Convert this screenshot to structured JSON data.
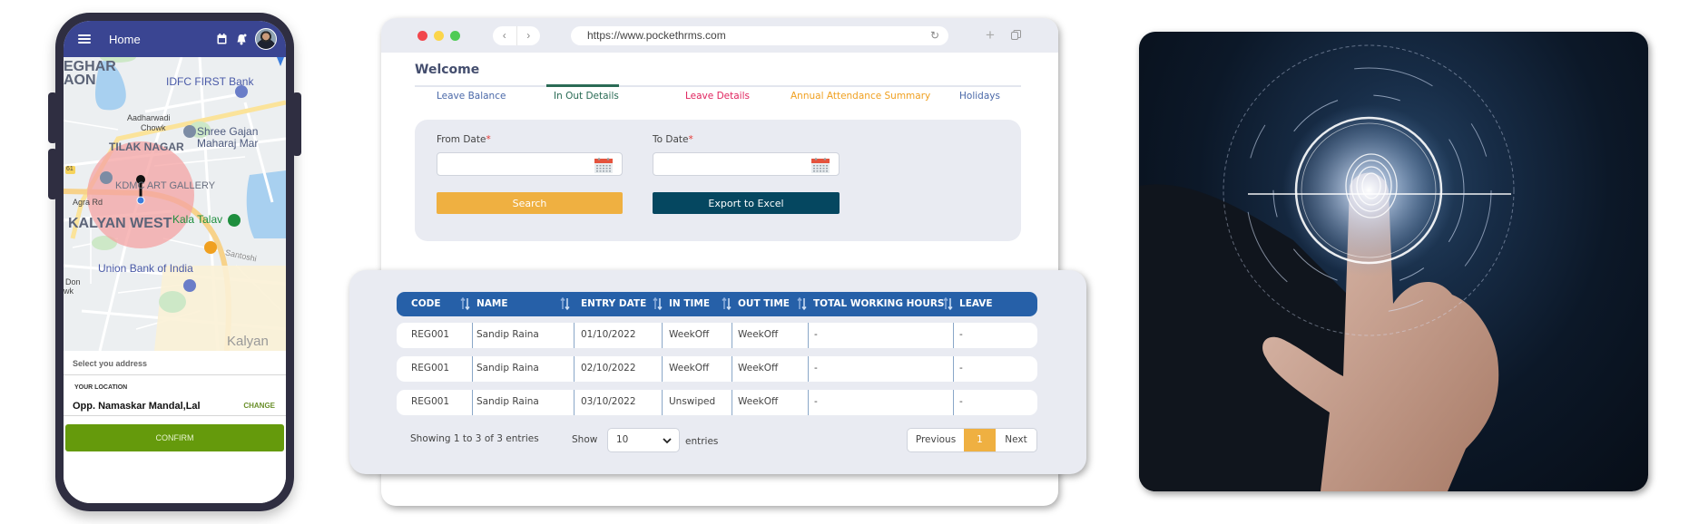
{
  "phone": {
    "header": {
      "menu_icon": "hamburger-icon",
      "title": "Home",
      "icons": [
        "calendar-icon",
        "bell-icon",
        "avatar"
      ]
    },
    "map": {
      "labels": {
        "eghar": "EGHAR",
        "aon": "AON",
        "idfc": "IDFC FIRST Bank",
        "aadharwadi": "Aadharwadi",
        "chowk": "Chowk",
        "tilak_nagar": "TILAK NAGAR",
        "shree1": "Shree Gajan",
        "shree2": "Maharaj Mar",
        "kdmc": "KDMC ART GALLERY",
        "agra_rd": "Agra Rd",
        "kalyan_west": "KALYAN WEST",
        "kala_talav": "Kala Talav",
        "santoshi": "Santoshi",
        "union_bank": "Union Bank of India",
        "don": "Don",
        "wk": "wk",
        "kalyan": "Kalyan",
        "road_61": "61"
      }
    },
    "address_placeholder": "Select you address",
    "your_location_label": "YOUR LOCATION",
    "location_value": "Opp. Namaskar Mandal,Lal",
    "change_label": "CHANGE",
    "confirm_label": "CONFIRM",
    "colors": {
      "header": "#3a4592",
      "confirm": "#659a0c"
    }
  },
  "browser": {
    "url": "https://www.pockethrms.com",
    "back_icon": "‹",
    "forward_icon": "›",
    "reload_icon": "↻",
    "new_tab_icon": "+",
    "welcome": "Welcome",
    "tabs": [
      {
        "label": "Leave Balance",
        "color": "#4a68a8",
        "active": false
      },
      {
        "label": "In Out Details",
        "color": "#2a6b55",
        "active": true
      },
      {
        "label": "Leave Details",
        "color": "#e0245e",
        "active": false
      },
      {
        "label": "Annual Attendance Summary",
        "color": "#f0a020",
        "active": false
      },
      {
        "label": "Holidays",
        "color": "#4a68a8",
        "active": false
      }
    ],
    "filters": {
      "from_label": "From Date",
      "to_label": "To Date",
      "required_mark": "*",
      "from_value": "",
      "to_value": "",
      "search_label": "Search",
      "export_label": "Export to Excel"
    },
    "colors": {
      "search": "#efb041",
      "export": "#054760",
      "table_header": "#2660a8"
    }
  },
  "table": {
    "columns": [
      "CODE",
      "NAME",
      "ENTRY DATE",
      "IN TIME",
      "OUT TIME",
      "TOTAL WORKING HOURS",
      "LEAVE"
    ],
    "rows": [
      [
        "REG001",
        "Sandip Raina",
        "01/10/2022",
        "WeekOff",
        "WeekOff",
        "-",
        "-"
      ],
      [
        "REG001",
        "Sandip Raina",
        "02/10/2022",
        "WeekOff",
        "WeekOff",
        "-",
        "-"
      ],
      [
        "REG001",
        "Sandip Raina",
        "03/10/2022",
        "Unswiped",
        "WeekOff",
        "-",
        "-"
      ]
    ],
    "showing": "Showing 1 to 3 of 3 entries",
    "show_label": "Show",
    "page_size": "10",
    "entries_label": "entries",
    "pagination": {
      "previous": "Previous",
      "current": "1",
      "next": "Next"
    }
  },
  "photo": {
    "subject": "fingerprint-scan-hand"
  }
}
